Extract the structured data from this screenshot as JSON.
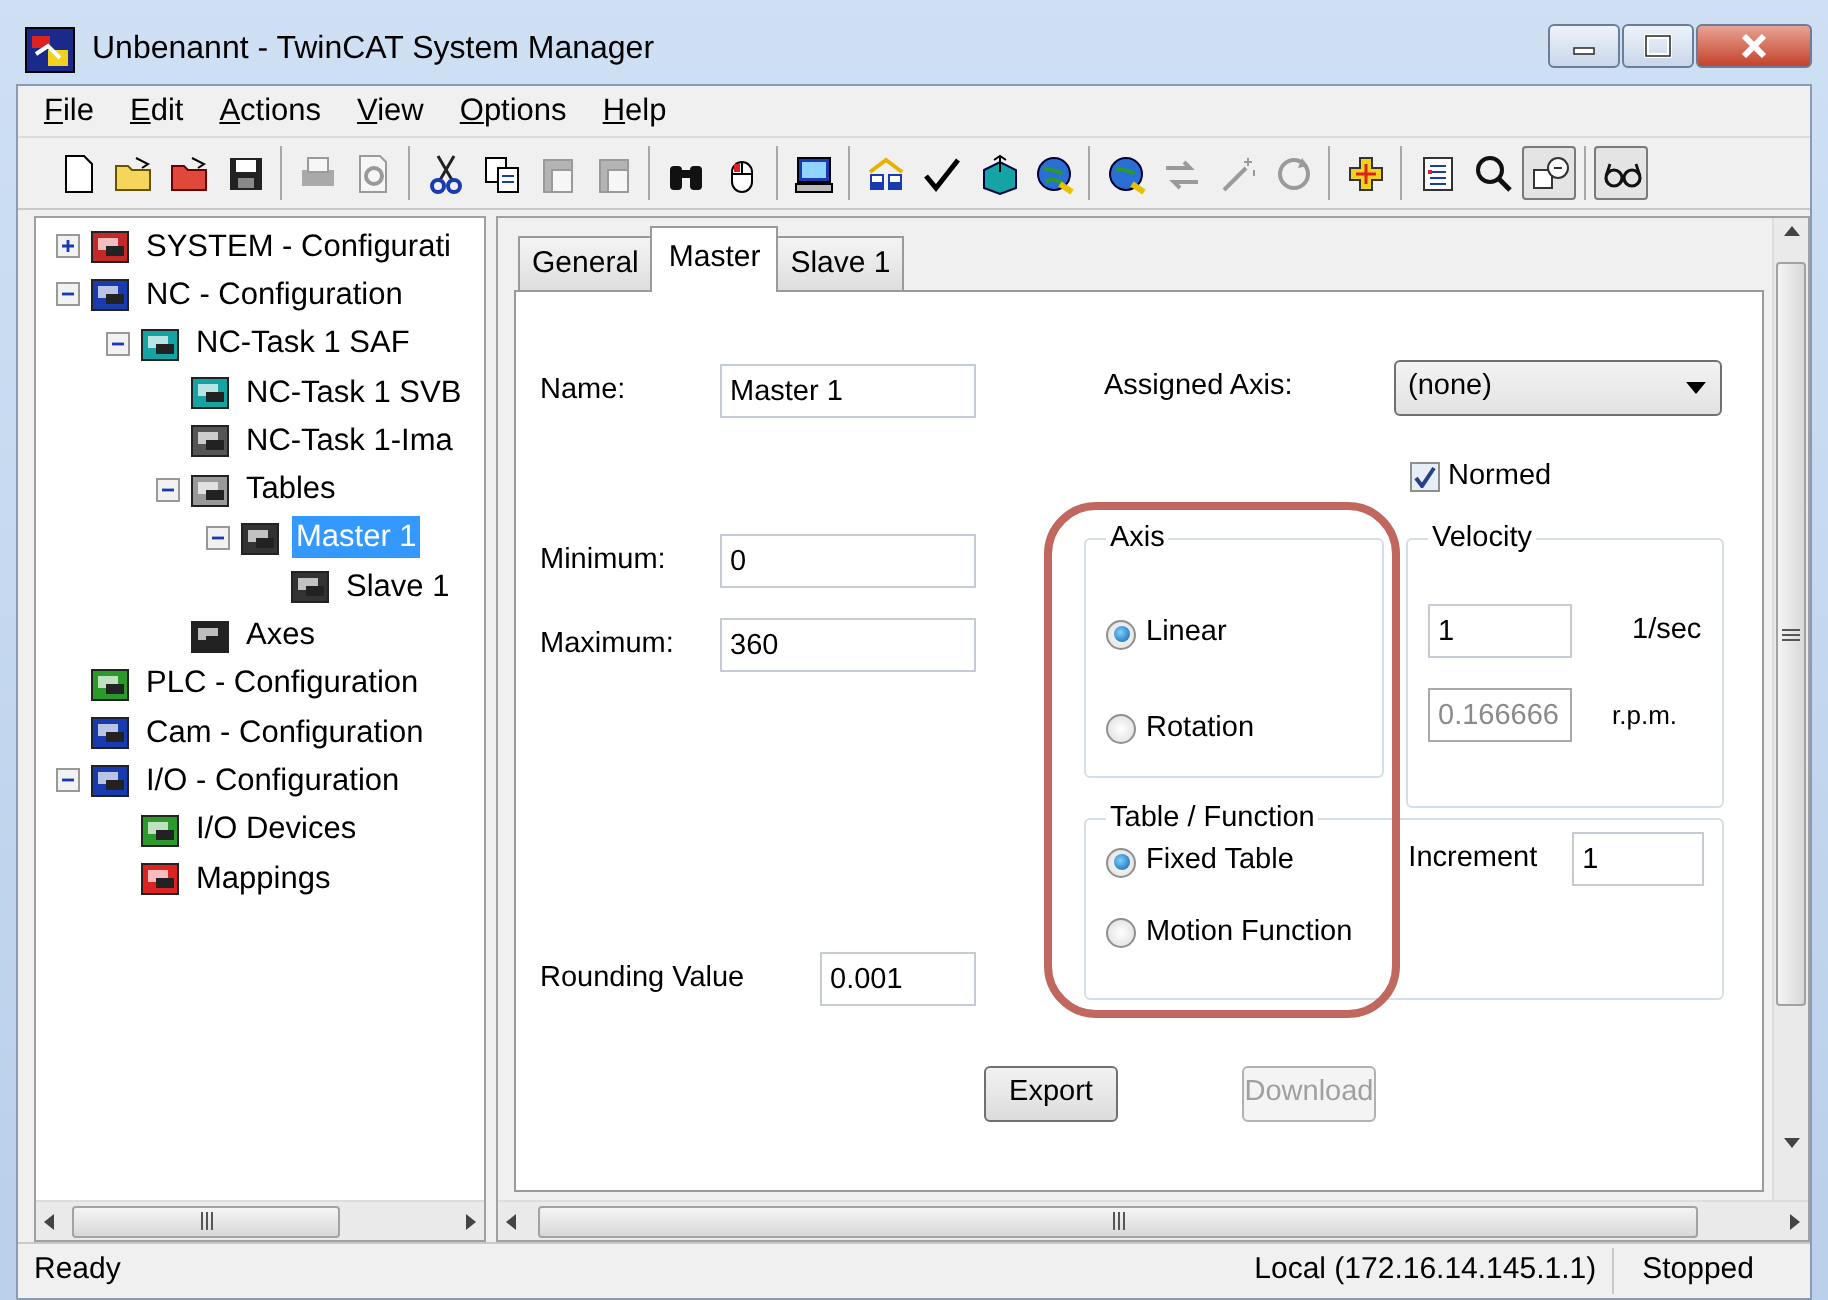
{
  "window": {
    "title": "Unbenannt - TwinCAT System Manager"
  },
  "menu": [
    "File",
    "Edit",
    "Actions",
    "View",
    "Options",
    "Help"
  ],
  "toolbar": [
    [
      {
        "disabled": false,
        "pressed": false
      },
      {
        "disabled": false,
        "pressed": false
      },
      {
        "disabled": false,
        "pressed": false
      },
      {
        "disabled": false,
        "pressed": false
      }
    ],
    [
      {
        "disabled": true,
        "pressed": false
      },
      {
        "disabled": true,
        "pressed": false
      }
    ],
    [
      {
        "disabled": false,
        "pressed": false
      },
      {
        "disabled": false,
        "pressed": false
      },
      {
        "disabled": true,
        "pressed": false
      },
      {
        "disabled": true,
        "pressed": false
      }
    ],
    [
      {
        "disabled": false,
        "pressed": false
      },
      {
        "disabled": false,
        "pressed": false
      }
    ],
    [
      {
        "disabled": false,
        "pressed": false
      }
    ],
    [
      {
        "disabled": false,
        "pressed": false
      },
      {
        "disabled": false,
        "pressed": false
      },
      {
        "disabled": false,
        "pressed": false
      },
      {
        "disabled": false,
        "pressed": false
      }
    ],
    [
      {
        "disabled": false,
        "pressed": false
      },
      {
        "disabled": true,
        "pressed": false
      },
      {
        "disabled": true,
        "pressed": false
      },
      {
        "disabled": true,
        "pressed": false
      }
    ],
    [
      {
        "disabled": false,
        "pressed": false
      }
    ],
    [
      {
        "disabled": false,
        "pressed": false
      },
      {
        "disabled": false,
        "pressed": false
      },
      {
        "disabled": false,
        "pressed": true
      }
    ],
    [
      {
        "disabled": false,
        "pressed": true
      }
    ]
  ],
  "tree": [
    {
      "label": "SYSTEM - Configurati",
      "expanded": false,
      "selected": false
    },
    {
      "label": "NC - Configuration",
      "expanded": true,
      "selected": false,
      "children": [
        {
          "label": "NC-Task 1 SAF",
          "expanded": true,
          "selected": false,
          "children": [
            {
              "label": "NC-Task 1 SVB",
              "selected": false
            },
            {
              "label": "NC-Task 1-Ima",
              "selected": false
            },
            {
              "label": "Tables",
              "expanded": true,
              "selected": false,
              "children": [
                {
                  "label": "Master 1",
                  "expanded": true,
                  "selected": true,
                  "children": [
                    {
                      "label": "Slave 1",
                      "selected": false
                    }
                  ]
                }
              ]
            },
            {
              "label": "Axes",
              "selected": false
            }
          ]
        }
      ]
    },
    {
      "label": "PLC - Configuration",
      "selected": false
    },
    {
      "label": "Cam - Configuration",
      "selected": false
    },
    {
      "label": "I/O - Configuration",
      "expanded": true,
      "selected": false,
      "children": [
        {
          "label": "I/O Devices",
          "selected": false
        },
        {
          "label": "Mappings",
          "selected": false
        }
      ]
    }
  ],
  "tabs": [
    {
      "label": "General",
      "selected": false
    },
    {
      "label": "Master",
      "selected": true
    },
    {
      "label": "Slave 1",
      "selected": false
    }
  ],
  "form": {
    "name": {
      "label": "Name:",
      "value": "Master 1"
    },
    "minimum": {
      "label": "Minimum:",
      "value": "0"
    },
    "maximum": {
      "label": "Maximum:",
      "value": "360"
    },
    "rounding": {
      "label": "Rounding Value",
      "value": "0.001"
    },
    "assigned_axis": {
      "label": "Assigned Axis:",
      "value": "(none)"
    },
    "normed": {
      "label": "Normed",
      "checked": true
    },
    "axis_group": {
      "title": "Axis",
      "options": [
        {
          "label": "Linear",
          "selected": true
        },
        {
          "label": "Rotation",
          "selected": false
        }
      ]
    },
    "velocity_group": {
      "title": "Velocity",
      "rows": [
        {
          "value": "1",
          "unit": "1/sec",
          "disabled": false
        },
        {
          "value": "0.166666",
          "unit": "r.p.m.",
          "disabled": true
        }
      ]
    },
    "table_group": {
      "title": "Table / Function",
      "options": [
        {
          "label": "Fixed Table",
          "selected": true
        },
        {
          "label": "Motion Function",
          "selected": false
        }
      ],
      "increment": {
        "label": "Increment",
        "value": "1"
      }
    },
    "buttons": [
      {
        "label": "Export",
        "disabled": false
      },
      {
        "label": "Download",
        "disabled": true
      }
    ]
  },
  "status_bar": {
    "message": "Ready",
    "connection": "Local (172.16.14.145.1.1)",
    "state": "Stopped"
  }
}
